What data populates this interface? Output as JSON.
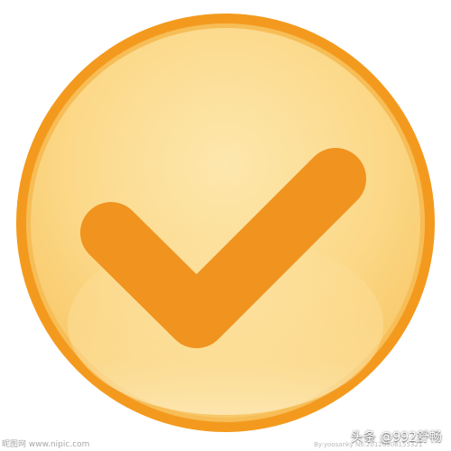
{
  "icon": {
    "name": "checkmark-icon",
    "colors": {
      "ring": "#f39a1e",
      "fill_top": "#fde3a0",
      "fill_bottom": "#fbd070",
      "check": "#f0931f"
    }
  },
  "watermarks": {
    "left": "昵图网 www.nipic.com",
    "middle": "By:yoosanky No:20120506155321",
    "right": "头条 @992舒畅"
  }
}
